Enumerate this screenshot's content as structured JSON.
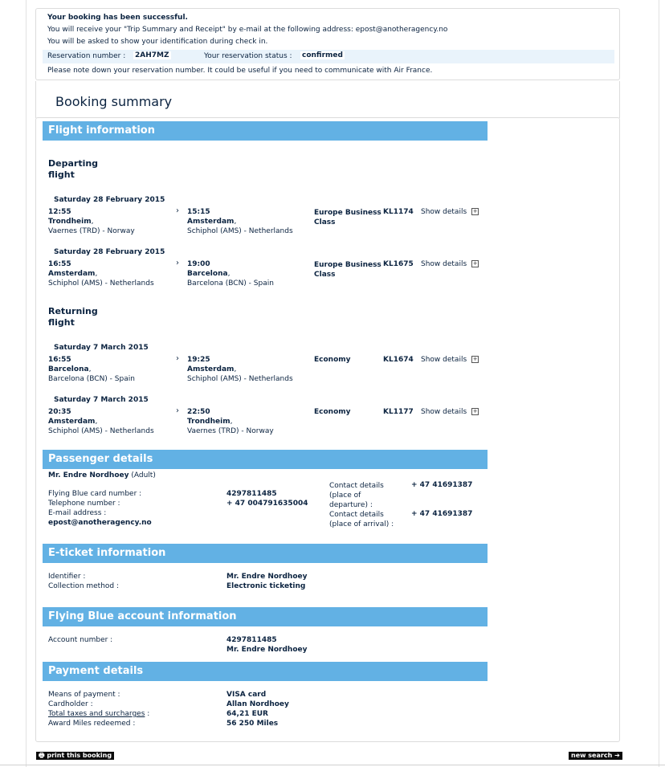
{
  "confirmation": {
    "success": "Your booking has been successful.",
    "email_line": "You will receive your \"Trip Summary and Receipt\" by e-mail at the following address: epost@anotheragency.no",
    "id_line": "You will be asked to show your identification during check in.",
    "res_label": "Reservation number :",
    "res_value": "2AH7MZ",
    "status_label": "Your reservation status :",
    "status_value": "confirmed",
    "note": "Please note down your reservation number. It could be useful if you need to communicate with Air France."
  },
  "summary_title": "Booking summary",
  "flight": {
    "header": "Flight information",
    "departing_title": "Departing flight",
    "returning_title": "Returning flight",
    "show_details": "Show details",
    "segments": [
      {
        "date": "Saturday 28 February 2015",
        "dep_time": "12:55",
        "dep_city": "Trondheim",
        "dep_airport": "Vaernes (TRD) - Norway",
        "arr_time": "15:15",
        "arr_city": "Amsterdam",
        "arr_airport": "Schiphol (AMS) - Netherlands",
        "cabin": "Europe Business Class",
        "flight": "KL1174"
      },
      {
        "date": "Saturday 28 February 2015",
        "dep_time": "16:55",
        "dep_city": "Amsterdam",
        "dep_airport": "Schiphol (AMS) - Netherlands",
        "arr_time": "19:00",
        "arr_city": "Barcelona",
        "arr_airport": "Barcelona (BCN) - Spain",
        "cabin": "Europe Business Class",
        "flight": "KL1675"
      },
      {
        "date": "Saturday 7 March 2015",
        "dep_time": "16:55",
        "dep_city": "Barcelona",
        "dep_airport": "Barcelona (BCN) - Spain",
        "arr_time": "19:25",
        "arr_city": "Amsterdam",
        "arr_airport": "Schiphol (AMS) - Netherlands",
        "cabin": "Economy",
        "flight": "KL1674"
      },
      {
        "date": "Saturday 7 March 2015",
        "dep_time": "20:35",
        "dep_city": "Amsterdam",
        "dep_airport": "Schiphol (AMS) - Netherlands",
        "arr_time": "22:50",
        "arr_city": "Trondheim",
        "arr_airport": "Vaernes (TRD) - Norway",
        "cabin": "Economy",
        "flight": "KL1177"
      }
    ]
  },
  "passenger": {
    "header": "Passenger details",
    "name": "Mr. Endre Nordhoey",
    "type": "(Adult)",
    "fb_label": "Flying Blue card number :",
    "fb_value": "4297811485",
    "tel_label": "Telephone number :",
    "tel_value": "+ 47 004791635004",
    "email_label": "E-mail address :",
    "email_value": "epost@anotheragency.no",
    "contact_dep_label": "Contact details (place of departure) :",
    "contact_dep_value": "+ 47 41691387",
    "contact_arr_label": "Contact details (place of arrival) :",
    "contact_arr_value": "+ 47 41691387"
  },
  "eticket": {
    "header": "E-ticket information",
    "id_label": "Identifier :",
    "id_value": "Mr. Endre Nordhoey",
    "method_label": "Collection method :",
    "method_value": "Electronic ticketing"
  },
  "flyingblue": {
    "header": "Flying Blue account information",
    "account_label": "Account number :",
    "account_value": "4297811485",
    "account_name": "Mr. Endre Nordhoey"
  },
  "payment": {
    "header": "Payment details",
    "means_label": "Means of payment :",
    "means_value": "VISA card",
    "holder_label": "Cardholder :",
    "holder_value": "Allan Nordhoey",
    "taxes_label": "Total taxes and surcharges",
    "taxes_colon": ":",
    "taxes_value": "64,21 EUR",
    "miles_label": "Award Miles redeemed :",
    "miles_value": "56 250 Miles"
  },
  "buttons": {
    "print": "print this booking",
    "new_search": "new search"
  },
  "icons": {
    "print": "printer-icon",
    "arrow": "arrow-right-icon",
    "chevron": "chevron-right-icon",
    "expand": "plus-box-icon"
  },
  "colors": {
    "section_header": "#62b1e4",
    "text": "#0b2340",
    "reservation_bar": "#e9f3fb"
  }
}
